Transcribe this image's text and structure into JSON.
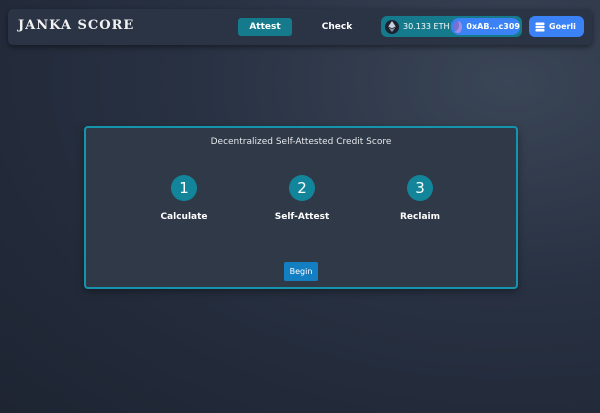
{
  "header": {
    "brand": "JANKA SCORE",
    "nav": {
      "attest": "Attest",
      "check": "Check"
    },
    "wallet": {
      "balance": "30.133 ETH",
      "address": "0xAB...c309",
      "network": "Goerli"
    }
  },
  "card": {
    "title": "Decentralized Self-Attested Credit Score",
    "steps": [
      {
        "number": "1",
        "label": "Calculate"
      },
      {
        "number": "2",
        "label": "Self-Attest"
      },
      {
        "number": "3",
        "label": "Reclaim"
      }
    ],
    "begin_label": "Begin"
  },
  "icons": {
    "balance": "ethereum-icon",
    "account": "account-avatar-icon",
    "network": "layers-icon"
  },
  "colors": {
    "accent_teal": "#147a8c",
    "card_border": "#1595ad",
    "account_blue": "#3b82f6",
    "begin_blue": "#147ec2"
  }
}
